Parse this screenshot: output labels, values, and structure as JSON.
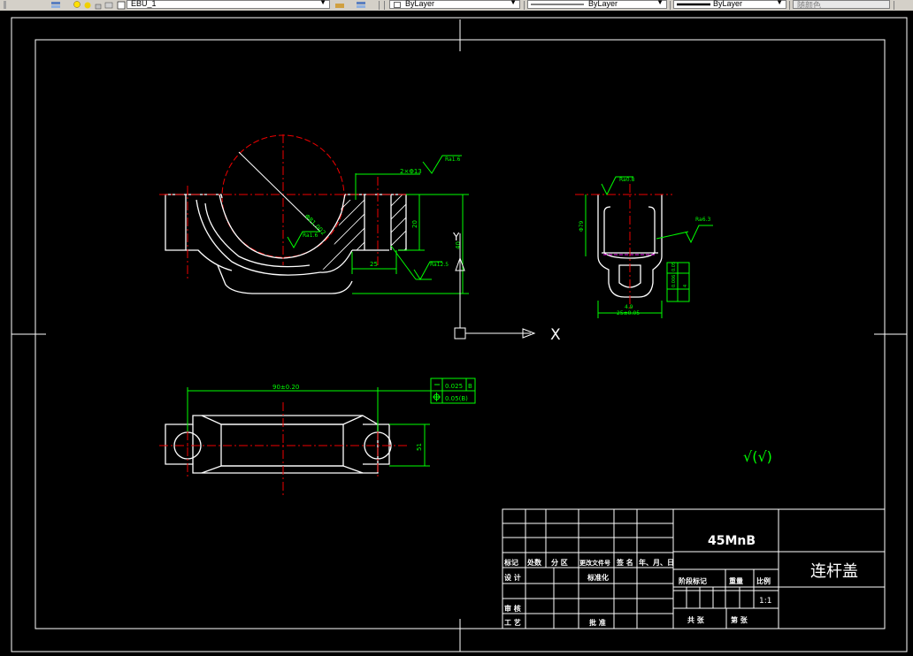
{
  "toolbar": {
    "layer_name": "EBU_1",
    "color_combo": "ByLayer",
    "linetype_combo": "ByLayer",
    "lineweight_combo": "ByLayer",
    "plotstyle_combo": "随颜色"
  },
  "ucs": {
    "x_label": "X",
    "y_label": "Y"
  },
  "drawing": {
    "front_view": {
      "dim_diameter": "Φ81.002",
      "dim_width": "25",
      "dim_depth": "20",
      "dim_height": "40",
      "dim_holes": "2×Φ13",
      "rough_top": "Ra1.6",
      "rough_bore": "Ra1.6",
      "rough_bottom": "Ra12.5"
    },
    "side_view": {
      "rough_top": "Ra0.8",
      "rough_side": "Ra6.3",
      "dim_inner": "Φ79",
      "dim_bottom": "25±0.05",
      "dim_bottom2": "4.9",
      "tol_a": "0.05",
      "tol_b": "0.006",
      "tol_c": "4"
    },
    "top_view": {
      "dim_span": "90±0.20",
      "dim_height": "51",
      "tol_flat": "0.025",
      "tol_flat_ref": "B",
      "tol_pos": "0.05(B)"
    },
    "roughness_note": "√(√)"
  },
  "title_block": {
    "material": "45MnB",
    "part_name": "连杆盖",
    "scale": "1:1",
    "headers": [
      "标记",
      "处数",
      "分 区",
      "更改文件号",
      "签 名",
      "年、月、日"
    ],
    "row_design": "设 计",
    "row_standard": "标准化",
    "row_review": "审 核",
    "row_process": "工 艺",
    "row_approve": "批 准",
    "stage_mark": "阶段标记",
    "weight": "重量",
    "ratio": "比例",
    "sheets_total": "共  张",
    "sheet_no": "第  张"
  }
}
